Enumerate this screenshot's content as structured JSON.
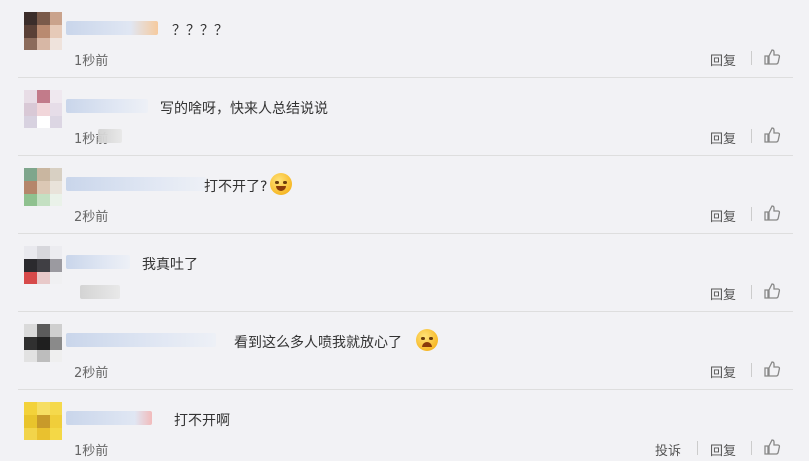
{
  "comments": [
    {
      "text": "？？？？",
      "time": "1秒前",
      "reply": "回复"
    },
    {
      "text": "写的啥呀，快来人总结说说",
      "time": "1秒前",
      "reply": "回复"
    },
    {
      "text": "打不开了?",
      "time": "2秒前",
      "reply": "回复"
    },
    {
      "text": "我真吐了",
      "time": "2秒前",
      "reply": "回复"
    },
    {
      "text": "看到这么多人喷我就放心了",
      "time": "2秒前",
      "reply": "回复"
    },
    {
      "text": "打不开啊",
      "time": "1秒前",
      "reply": "回复",
      "report": "投诉"
    }
  ],
  "icons": {
    "like": "thumbs-up-icon",
    "emoji_sweat": "sweat-smile-emoji",
    "emoji_relief": "relieved-emoji"
  },
  "colors": {
    "background": "#f2f2f5",
    "separator": "#dedede",
    "text": "#333333",
    "meta": "#666666"
  }
}
